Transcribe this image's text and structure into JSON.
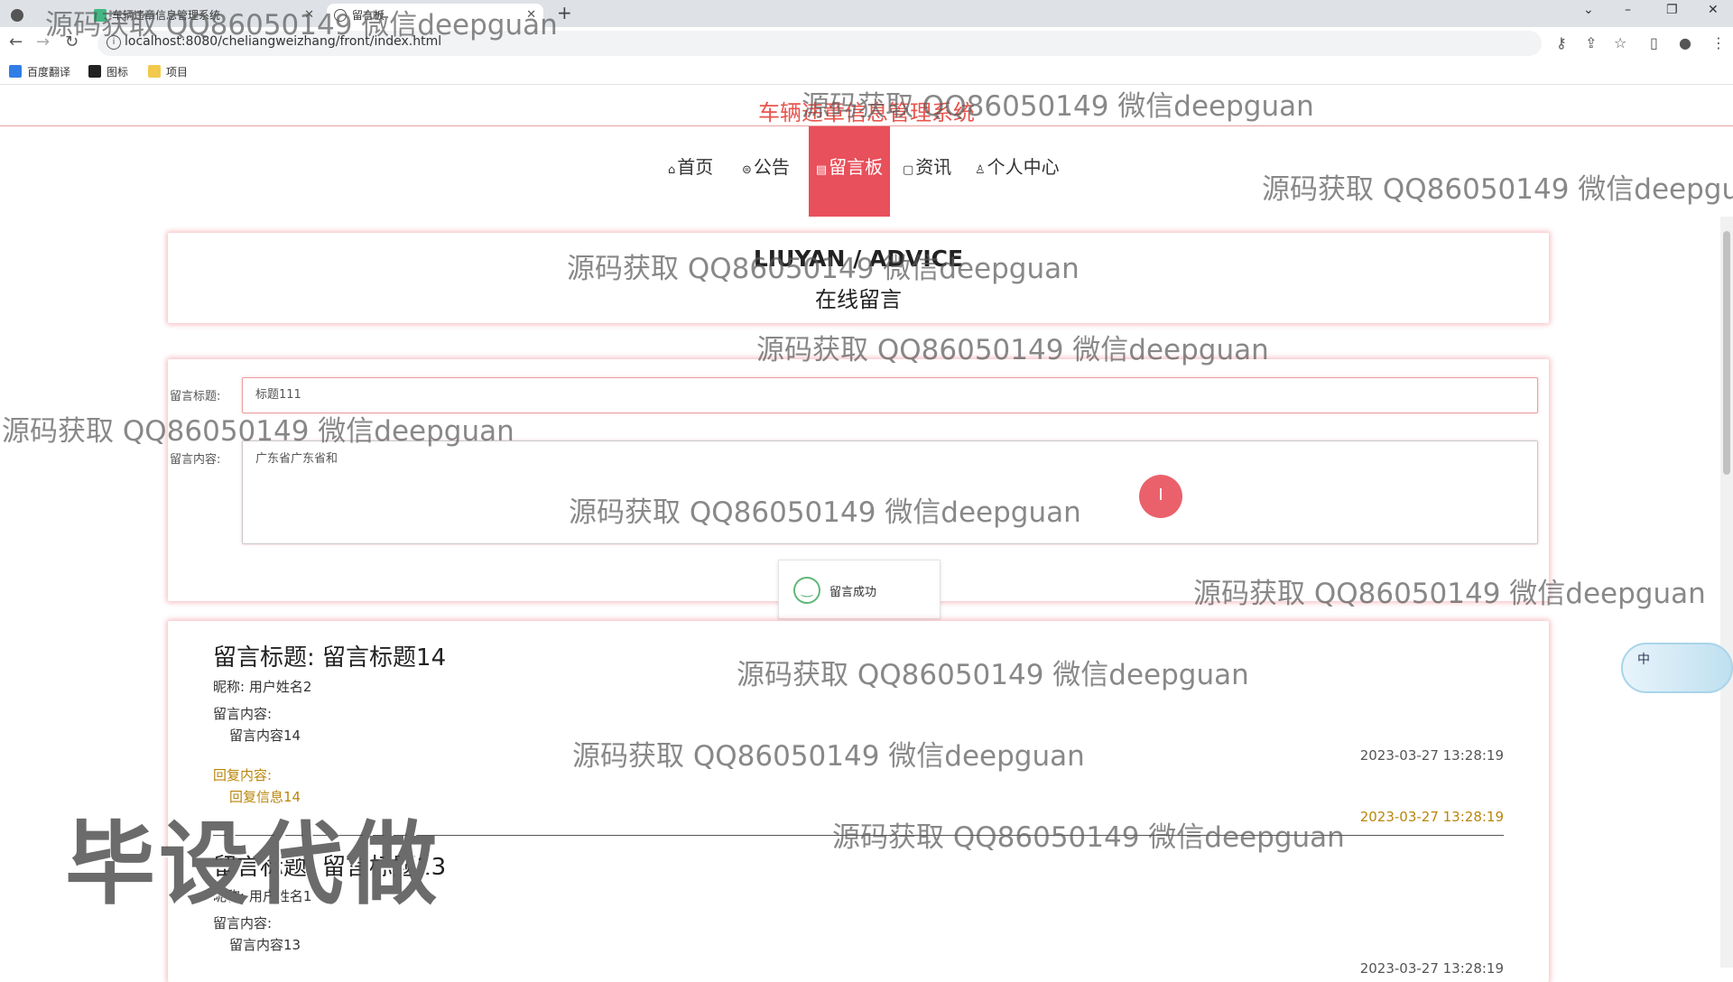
{
  "browser": {
    "tabs": [
      {
        "label": "",
        "icon": "chrome-icon"
      },
      {
        "label": "车辆违章信息管理系统",
        "icon": "vue-icon"
      },
      {
        "label": "留言板",
        "icon": "globe-icon"
      }
    ],
    "url": "localhost:8080/cheliangweizhang/front/index.html",
    "bookmarks": [
      "百度翻译",
      "图标",
      "项目"
    ]
  },
  "site": {
    "title": "车辆违章信息管理系统",
    "nav": [
      {
        "label": "首页",
        "icon": "home-icon"
      },
      {
        "label": "公告",
        "icon": "notice-icon"
      },
      {
        "label": "留言板",
        "icon": "message-icon",
        "active": true
      },
      {
        "label": "资讯",
        "icon": "news-icon"
      },
      {
        "label": "个人中心",
        "icon": "user-icon"
      }
    ]
  },
  "section": {
    "title_en": "LIUYAN / ADVICE",
    "title_cn": "在线留言"
  },
  "form": {
    "title_label": "留言标题:",
    "title_value": "标题111",
    "content_label": "留言内容:",
    "content_value": "广东省广东省和"
  },
  "toast": {
    "message": "留言成功"
  },
  "messages": [
    {
      "title": "留言标题:  留言标题14",
      "nickname": "昵称:  用户姓名2",
      "content_label": "留言内容:",
      "content": "留言内容14",
      "time": "2023-03-27 13:28:19",
      "reply_label": "回复内容:",
      "reply": "回复信息14",
      "reply_time": "2023-03-27 13:28:19"
    },
    {
      "title": "留言标题:  留言标题13",
      "nickname": "昵称:  用户姓名1",
      "content_label": "留言内容:",
      "content": "留言内容13",
      "time": "2023-03-27 13:28:19"
    }
  ],
  "widget": {
    "label": "中"
  },
  "watermarks": {
    "text": "源码获取 QQ86050149 微信deepguan",
    "stamp": "毕设代做"
  },
  "colors": {
    "accent": "#e8505b",
    "title_red": "#e8554e",
    "reply": "#b8860b",
    "success": "#5fb878"
  }
}
